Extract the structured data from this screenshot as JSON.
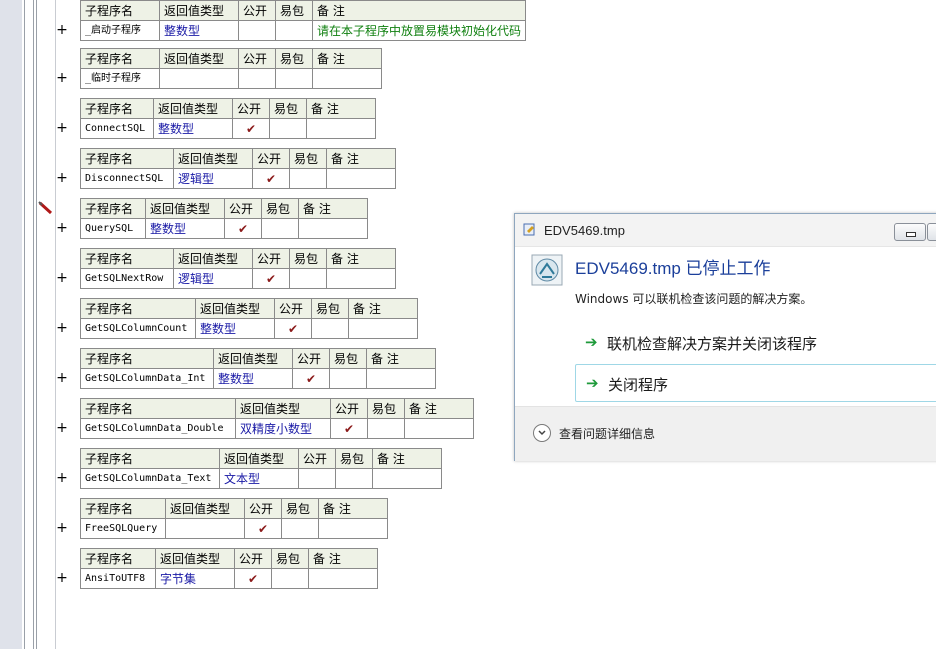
{
  "subroutines": [
    {
      "name": "_启动子程序",
      "type": "整数型",
      "public": false,
      "note": "请在本子程序中放置易模块初始化代码"
    },
    {
      "name": "_临时子程序",
      "type": "",
      "public": false,
      "note": ""
    },
    {
      "name": "ConnectSQL",
      "type": "整数型",
      "public": true,
      "note": ""
    },
    {
      "name": "DisconnectSQL",
      "type": "逻辑型",
      "public": true,
      "note": ""
    },
    {
      "name": "QuerySQL",
      "type": "整数型",
      "public": true,
      "note": ""
    },
    {
      "name": "GetSQLNextRow",
      "type": "逻辑型",
      "public": true,
      "note": ""
    },
    {
      "name": "GetSQLColumnCount",
      "type": "整数型",
      "public": true,
      "note": ""
    },
    {
      "name": "GetSQLColumnData_Int",
      "type": "整数型",
      "public": true,
      "note": ""
    },
    {
      "name": "GetSQLColumnData_Double",
      "type": "双精度小数型",
      "public": true,
      "note": ""
    },
    {
      "name": "GetSQLColumnData_Text",
      "type": "文本型",
      "public": false,
      "note": ""
    },
    {
      "name": "FreeSQLQuery",
      "type": "",
      "public": true,
      "note": ""
    },
    {
      "name": "AnsiToUTF8",
      "type": "字节集",
      "public": true,
      "note": ""
    }
  ],
  "headers": {
    "name": "子程序名",
    "type": "返回值类型",
    "public": "公开",
    "easy": "易包",
    "note": "备 注"
  },
  "expand_symbol": "+",
  "check_symbol": "✔",
  "dialog": {
    "title": "EDV5469.tmp",
    "heading": "EDV5469.tmp 已停止工作",
    "description": "Windows 可以联机检查该问题的解决方案。",
    "options": [
      "联机检查解决方案并关闭该程序",
      "关闭程序"
    ],
    "details": "查看问题详细信息"
  }
}
